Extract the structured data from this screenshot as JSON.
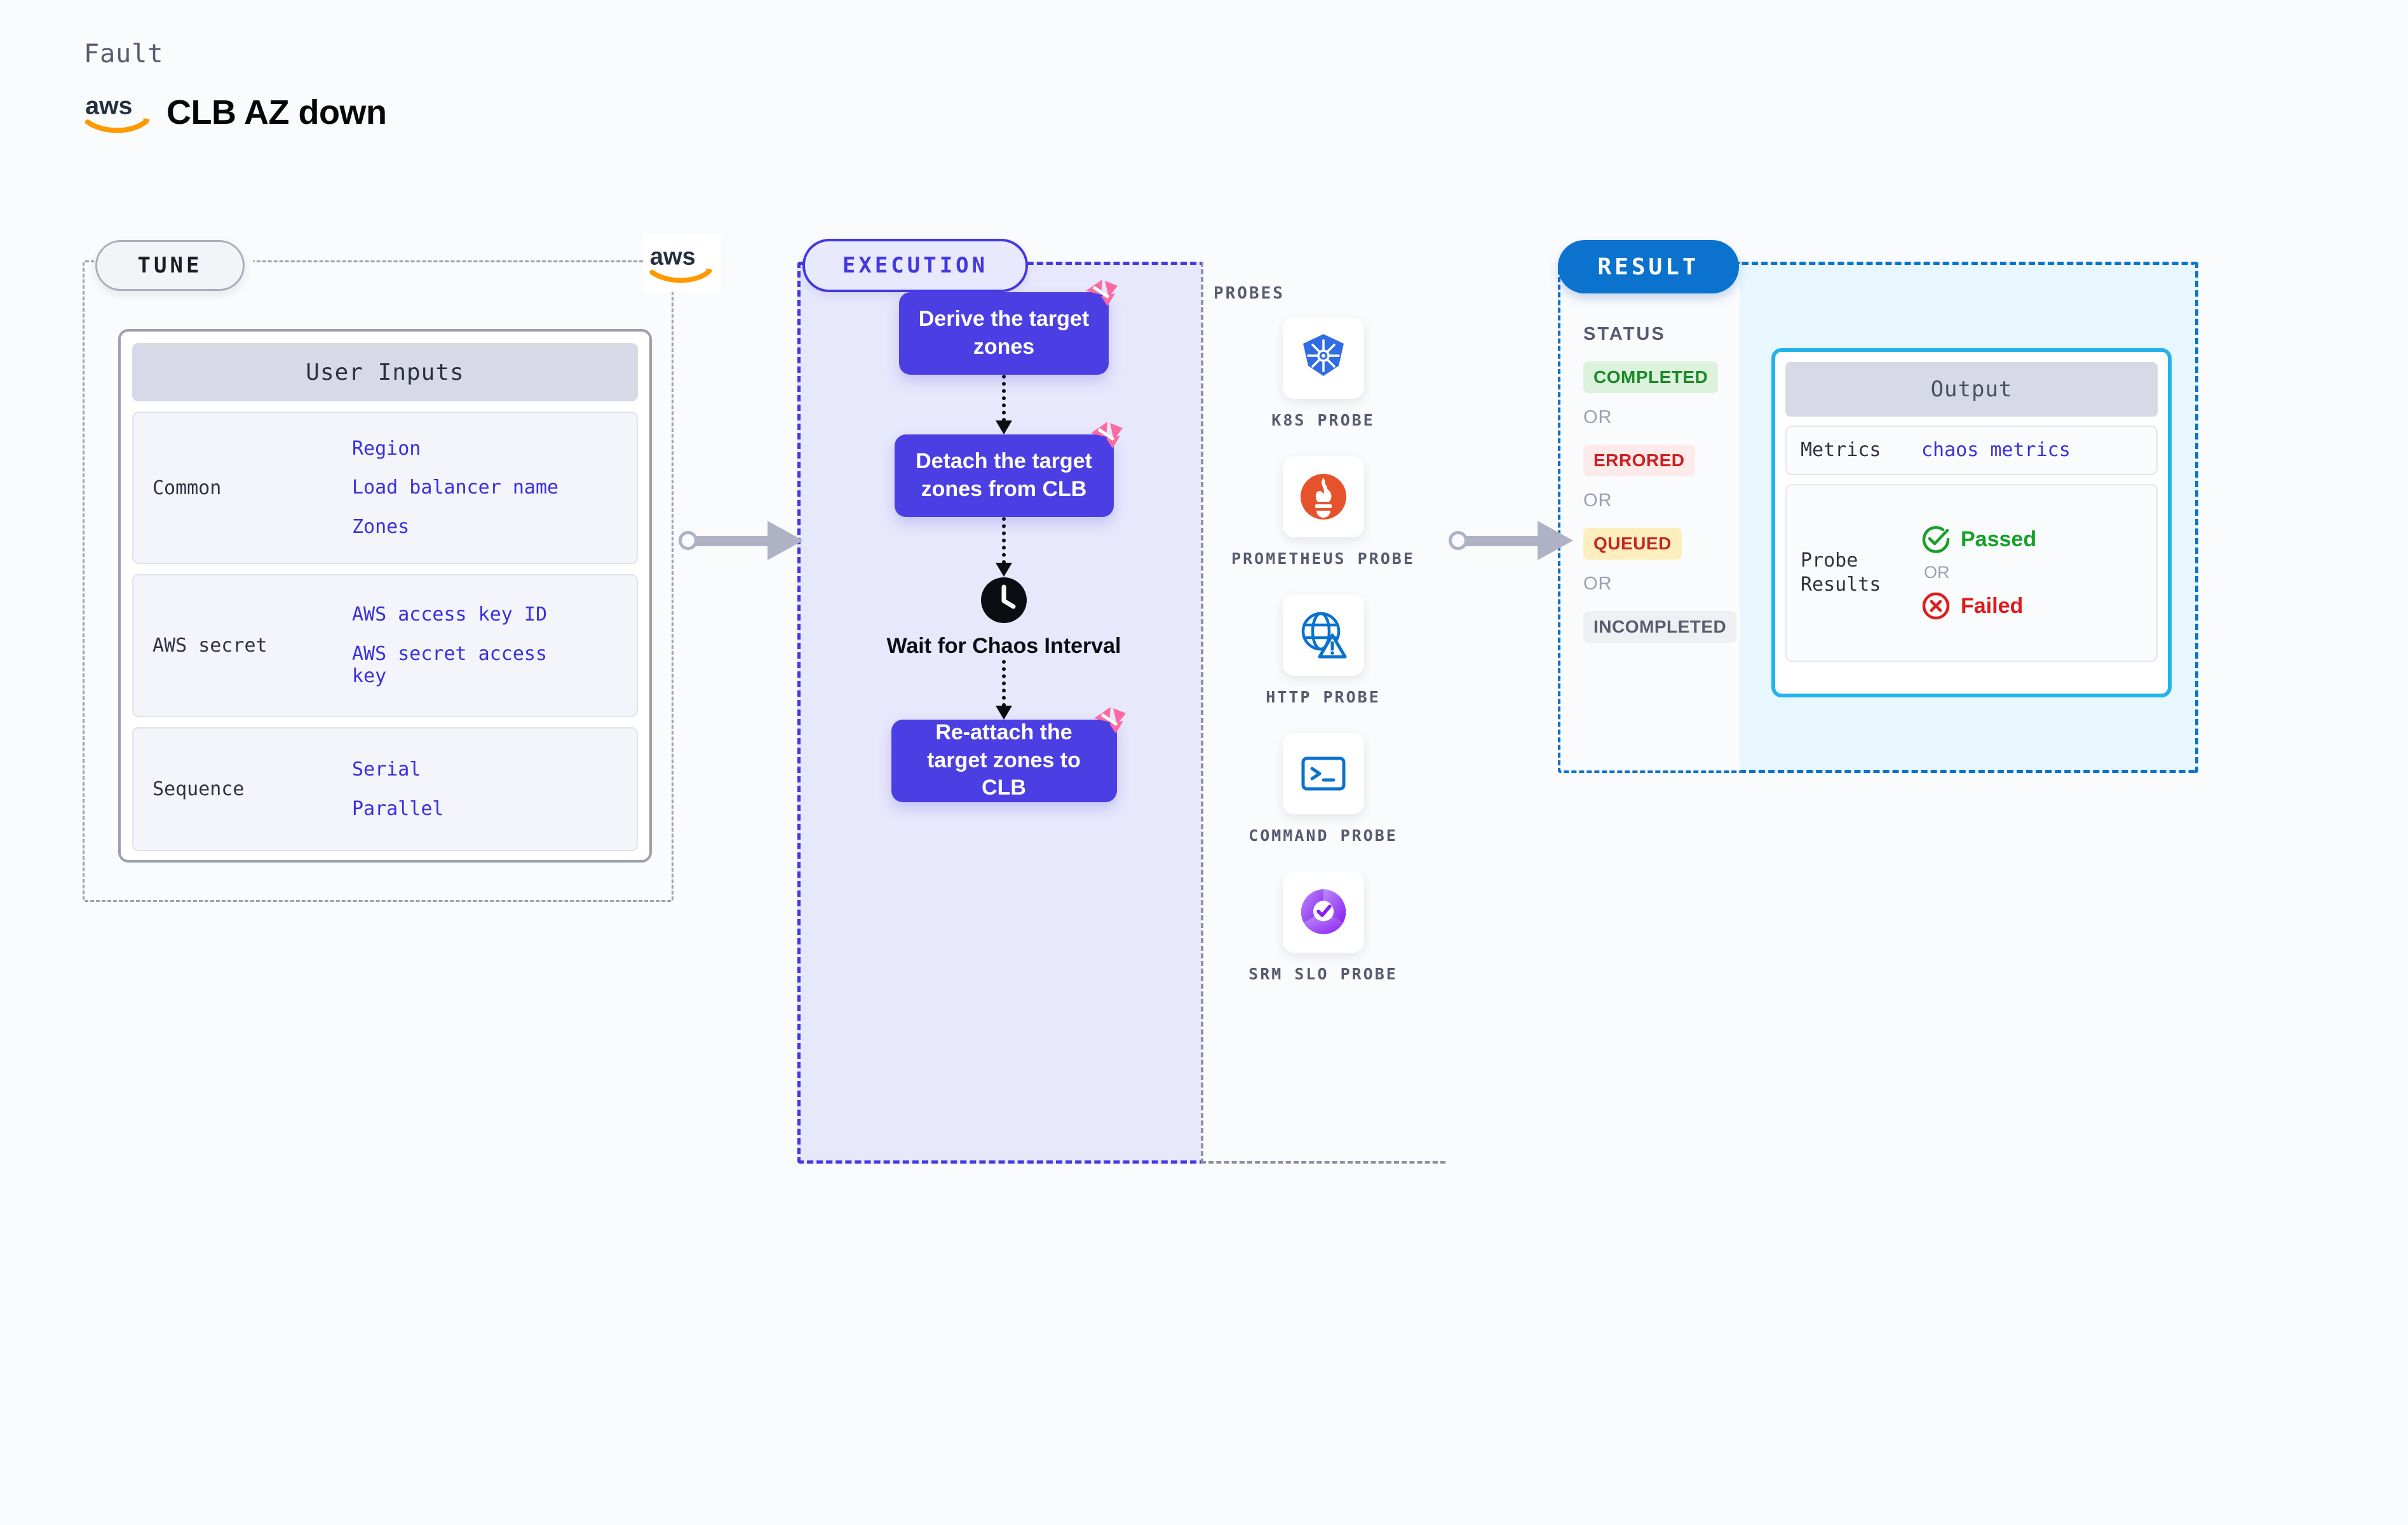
{
  "header": {
    "kicker": "Fault",
    "title": "CLB AZ down",
    "logo_icon": "aws-logo"
  },
  "tune": {
    "pill_label": "TUNE",
    "provider_icon": "aws-logo",
    "card_title": "User Inputs",
    "groups": [
      {
        "name": "Common",
        "fields": [
          "Region",
          "Load balancer name",
          "Zones"
        ]
      },
      {
        "name": "AWS secret",
        "fields": [
          "AWS access key ID",
          "AWS secret access key"
        ]
      },
      {
        "name": "Sequence",
        "fields": [
          "Serial",
          "Parallel"
        ]
      }
    ]
  },
  "execution": {
    "pill_label": "EXECUTION",
    "steps": [
      {
        "type": "box",
        "label": "Derive the target zones",
        "badge_icon": "litmus-ribbon-icon"
      },
      {
        "type": "box",
        "label": "Detach the target zones from CLB",
        "badge_icon": "litmus-ribbon-icon"
      },
      {
        "type": "wait",
        "label": "Wait for Chaos Interval",
        "badge_icon": "clock-icon"
      },
      {
        "type": "box",
        "label": "Re-attach the target zones to CLB",
        "badge_icon": "litmus-ribbon-icon"
      }
    ],
    "probes_label": "PROBES",
    "probes": [
      {
        "label": "K8S PROBE",
        "icon": "kubernetes-icon"
      },
      {
        "label": "PROMETHEUS PROBE",
        "icon": "prometheus-icon"
      },
      {
        "label": "HTTP PROBE",
        "icon": "globe-warning-icon"
      },
      {
        "label": "COMMAND PROBE",
        "icon": "terminal-icon"
      },
      {
        "label": "SRM SLO PROBE",
        "icon": "srm-slo-icon"
      }
    ]
  },
  "result": {
    "pill_label": "RESULT",
    "status_heading": "STATUS",
    "or_label": "OR",
    "statuses": [
      {
        "label": "COMPLETED",
        "text_color": "#1b8a28",
        "bg_color": "#ddf2dc"
      },
      {
        "label": "ERRORED",
        "text_color": "#cb2020",
        "bg_color": "#fdeaea"
      },
      {
        "label": "QUEUED",
        "text_color": "#c02626",
        "bg_color": "#fdeebd"
      },
      {
        "label": "INCOMPLETED",
        "text_color": "#565b6e",
        "bg_color": "#eef0f4"
      }
    ],
    "output": {
      "title": "Output",
      "metrics_label": "Metrics",
      "metrics_value": "chaos metrics",
      "probe_results_label": "Probe Results",
      "passed_label": "Passed",
      "passed_icon": "check-circle-icon",
      "passed_color": "#16a02a",
      "or_label": "OR",
      "failed_label": "Failed",
      "failed_icon": "x-circle-icon",
      "failed_color": "#e01b1b"
    }
  },
  "colors": {
    "accent_blue": "#0b72ce",
    "exec_violet": "#4338e0",
    "step_violet": "#4b3fe4",
    "mono_blue": "#3a2fe0",
    "badge_pink": "#fb6aa0",
    "output_border": "#23b3ea"
  }
}
